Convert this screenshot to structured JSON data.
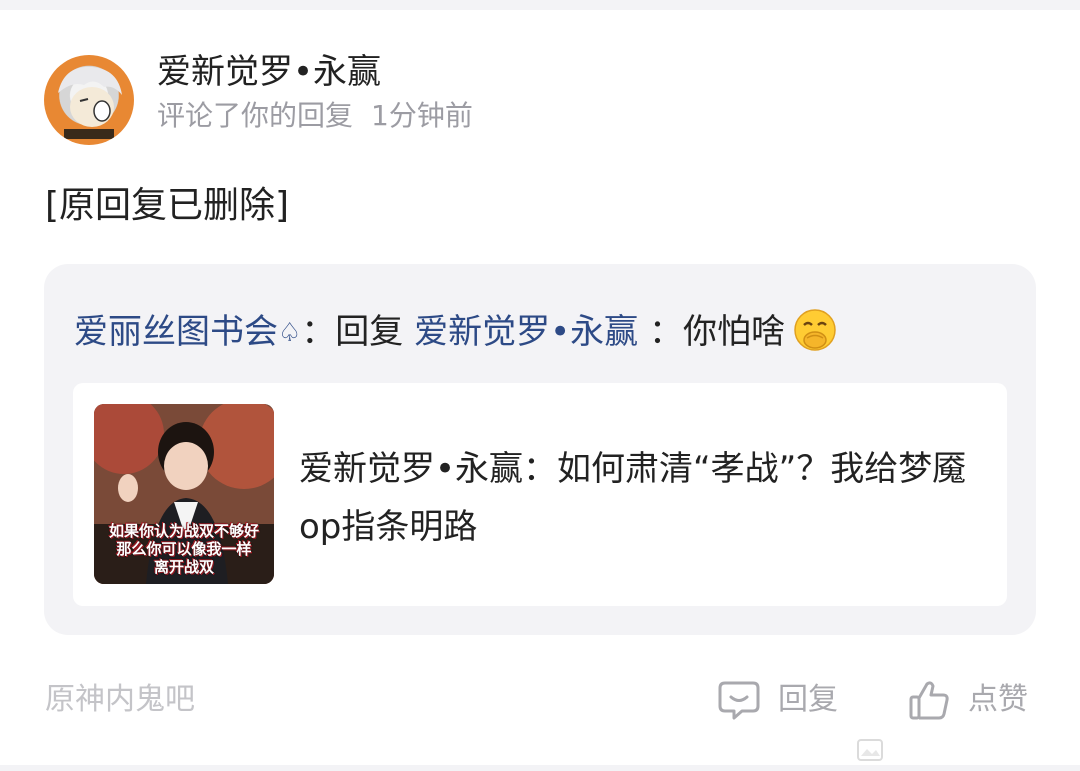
{
  "notification": {
    "username": "爱新觉罗•永赢",
    "action": "评论了你的回复",
    "time": "1分钟前",
    "content": "[原回复已删除]"
  },
  "quote": {
    "author": "爱丽丝图书会",
    "author_badge": "♤",
    "sep1": "：回复 ",
    "reply_to": "爱新觉罗•永赢",
    "text": " ：你怕啥",
    "emoji": "face-with-hand-over-mouth"
  },
  "post": {
    "text": "爱新觉罗•永赢：如何肃清“孝战”？我给梦魇op指条明路",
    "thumbnail_caption": [
      "如果你认为战双不够好",
      "那么你可以像我一样",
      "离开战双"
    ]
  },
  "footer": {
    "forum": "原神内鬼吧",
    "reply_label": "回复",
    "like_label": "点赞"
  },
  "colors": {
    "link_blue": "#2d4a86",
    "muted": "#9c9ca3",
    "box_bg": "#f3f3f6"
  }
}
